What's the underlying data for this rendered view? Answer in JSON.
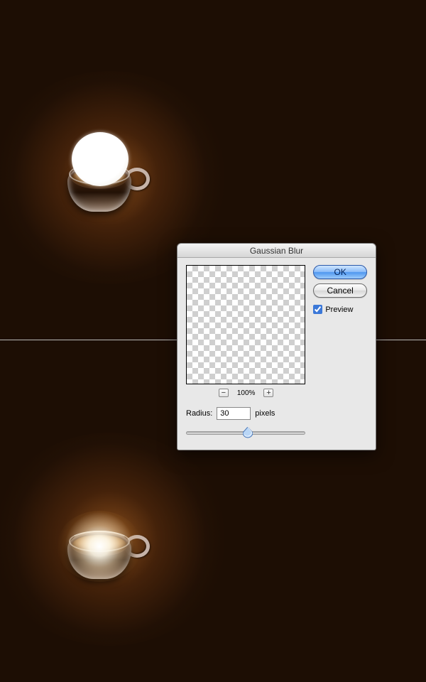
{
  "dialog": {
    "title": "Gaussian Blur",
    "ok_label": "OK",
    "cancel_label": "Cancel",
    "preview_label": "Preview",
    "zoom_level": "100%",
    "zoom_out": "−",
    "zoom_in": "+",
    "radius_label": "Radius:",
    "radius_value": "30",
    "radius_unit": "pixels"
  }
}
